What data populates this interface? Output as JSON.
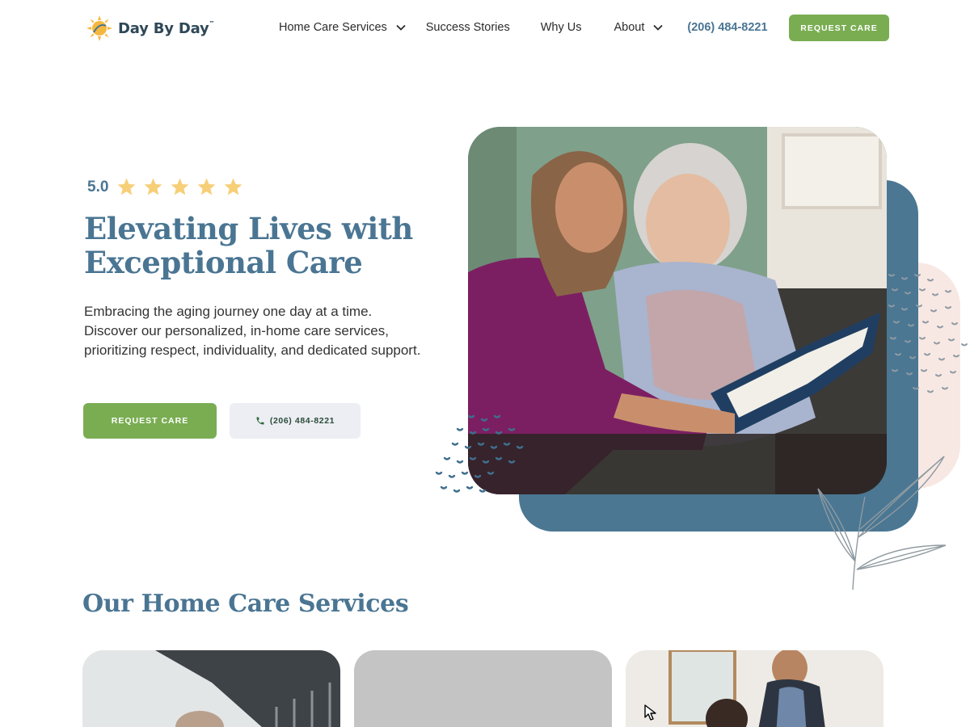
{
  "brand": {
    "name": "Day By Day",
    "trademark": "™",
    "logo_icon": "sun-logo-icon"
  },
  "nav": {
    "items": [
      {
        "label": "Home Care Services",
        "has_dropdown": true
      },
      {
        "label": "Success Stories",
        "has_dropdown": false
      },
      {
        "label": "Why Us",
        "has_dropdown": false
      },
      {
        "label": "About",
        "has_dropdown": true
      }
    ],
    "phone": "(206) 484-8221",
    "cta_label": "REQUEST CARE"
  },
  "hero": {
    "rating_value": "5.0",
    "rating_stars": 5,
    "title_line1": "Elevating Lives with",
    "title_line2": "Exceptional Care",
    "description": "Embracing the aging journey one day at a time. Discover our personalized, in-home care services, prioritizing respect, individuality, and dedicated support.",
    "primary_button": "REQUEST CARE",
    "secondary_button_phone": "(206) 484-8221",
    "secondary_button_icon": "phone-icon"
  },
  "services": {
    "title": "Our Home Care Services",
    "cards": [
      {
        "image": "caregiver-walking-photo"
      },
      {
        "image": "placeholder-photo"
      },
      {
        "image": "caregiver-assisting-photo"
      }
    ]
  },
  "colors": {
    "brand_blue": "#4a7593",
    "accent_green": "#7aad52",
    "star_gold": "#f6cf77",
    "secondary_button_bg": "#eceef3"
  }
}
